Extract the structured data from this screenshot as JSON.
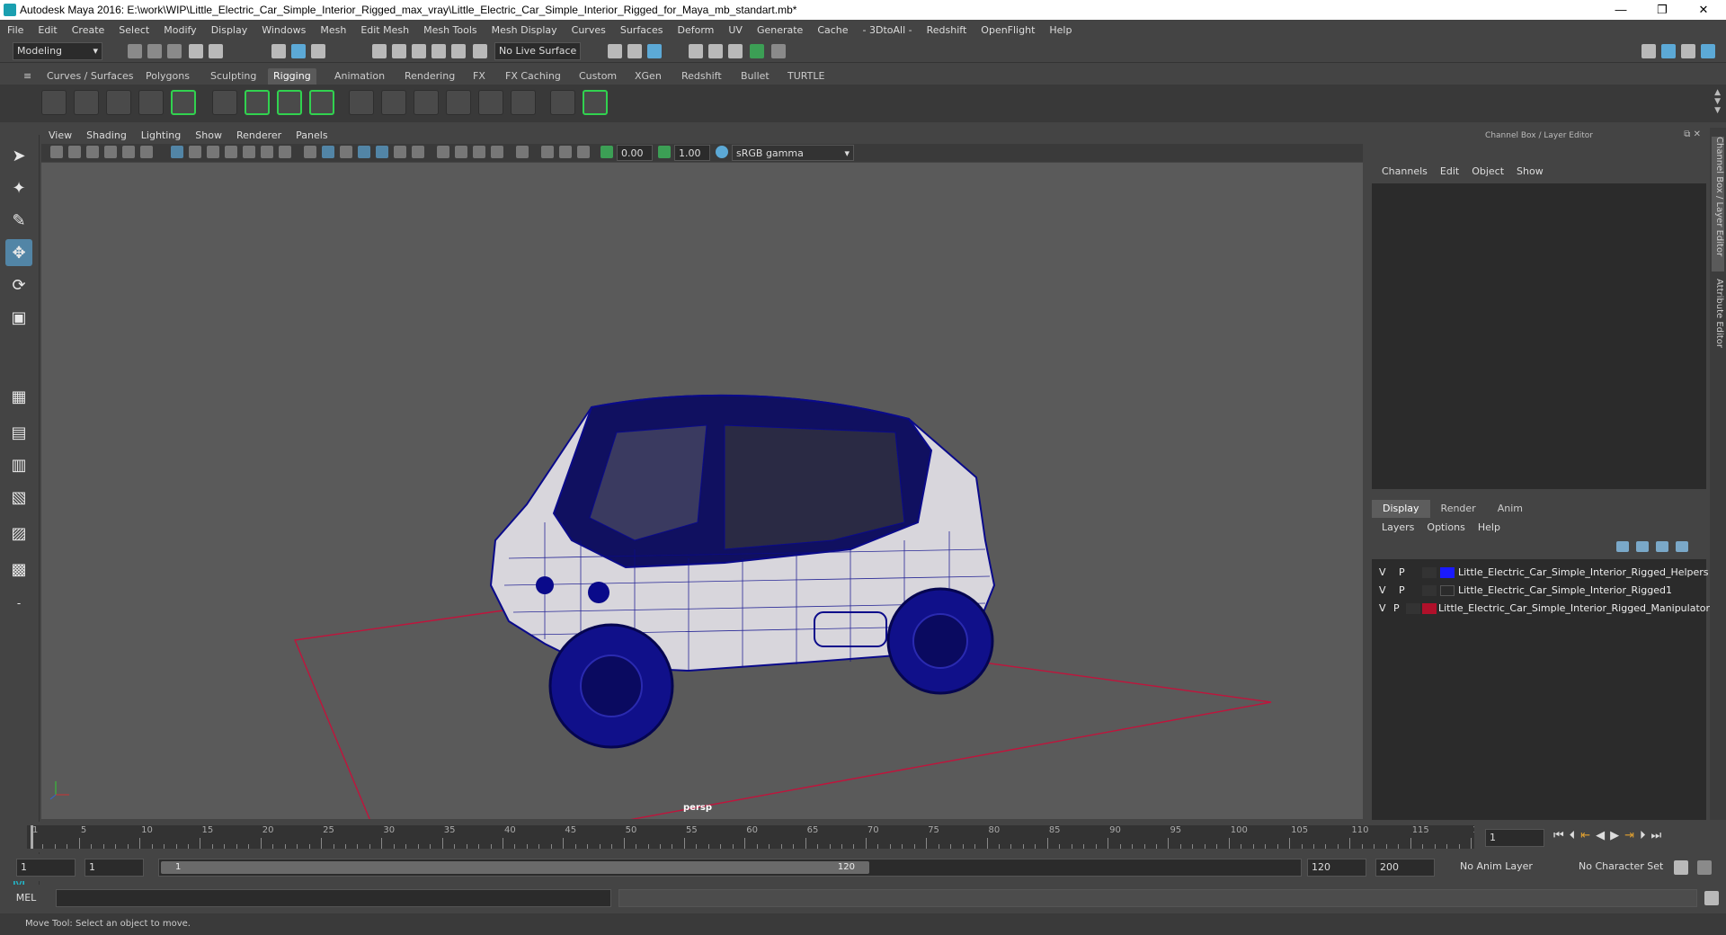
{
  "window": {
    "title": "Autodesk Maya 2016: E:\\work\\WIP\\Little_Electric_Car_Simple_Interior_Rigged_max_vray\\Little_Electric_Car_Simple_Interior_Rigged_for_Maya_mb_standart.mb*",
    "minimize": "—",
    "restore": "❐",
    "close": "✕"
  },
  "menubar": [
    "File",
    "Edit",
    "Create",
    "Select",
    "Modify",
    "Display",
    "Windows",
    "Mesh",
    "Edit Mesh",
    "Mesh Tools",
    "Mesh Display",
    "Curves",
    "Surfaces",
    "Deform",
    "UV",
    "Generate",
    "Cache",
    "- 3DtoAll -",
    "Redshift",
    "OpenFlight",
    "Help"
  ],
  "status": {
    "menuset": "Modeling",
    "live_surface": "No Live Surface"
  },
  "shelf_tabs": [
    "Curves / Surfaces",
    "Polygons",
    "Sculpting",
    "Rigging",
    "Animation",
    "Rendering",
    "FX",
    "FX Caching",
    "Custom",
    "XGen",
    "Redshift",
    "Bullet",
    "TURTLE"
  ],
  "viewport": {
    "menu": [
      "View",
      "Shading",
      "Lighting",
      "Show",
      "Renderer",
      "Panels"
    ],
    "exposure": "0.00",
    "gamma": "1.00",
    "colorspace": "sRGB gamma",
    "camera": "persp"
  },
  "channel_box": {
    "title": "Channel Box / Layer Editor",
    "menu": [
      "Channels",
      "Edit",
      "Object",
      "Show"
    ]
  },
  "layer_editor": {
    "tabs": [
      "Display",
      "Render",
      "Anim"
    ],
    "menu": [
      "Layers",
      "Options",
      "Help"
    ],
    "layers": [
      {
        "v": "V",
        "p": "P",
        "name": "Little_Electric_Car_Simple_Interior_Rigged_Helpers",
        "color": "#1a1aff"
      },
      {
        "v": "V",
        "p": "P",
        "name": "Little_Electric_Car_Simple_Interior_Rigged1",
        "color": ""
      },
      {
        "v": "V",
        "p": "P",
        "name": "Little_Electric_Car_Simple_Interior_Rigged_Manipulator",
        "color": "#b0102a"
      }
    ]
  },
  "side_tabs": [
    "Channel Box / Layer Editor",
    "Attribute Editor"
  ],
  "timeline": {
    "ticks": [
      "1",
      "5",
      "10",
      "15",
      "20",
      "25",
      "30",
      "35",
      "40",
      "45",
      "50",
      "55",
      "60",
      "65",
      "70",
      "75",
      "80",
      "85",
      "90",
      "95",
      "100",
      "105",
      "110",
      "115",
      "120"
    ],
    "current_frame": "1"
  },
  "range": {
    "start": "1",
    "playback_start": "1",
    "slider_start": "1",
    "slider_end": "120",
    "playback_end": "120",
    "end": "200",
    "anim_layer": "No Anim Layer",
    "character_set": "No Character Set"
  },
  "mel": {
    "label": "MEL"
  },
  "help": {
    "text": "Move Tool: Select an object to move."
  },
  "colors": {
    "accent": "#5285a6",
    "wire": "#0a0a8a",
    "grid_line": "#c0143c"
  }
}
